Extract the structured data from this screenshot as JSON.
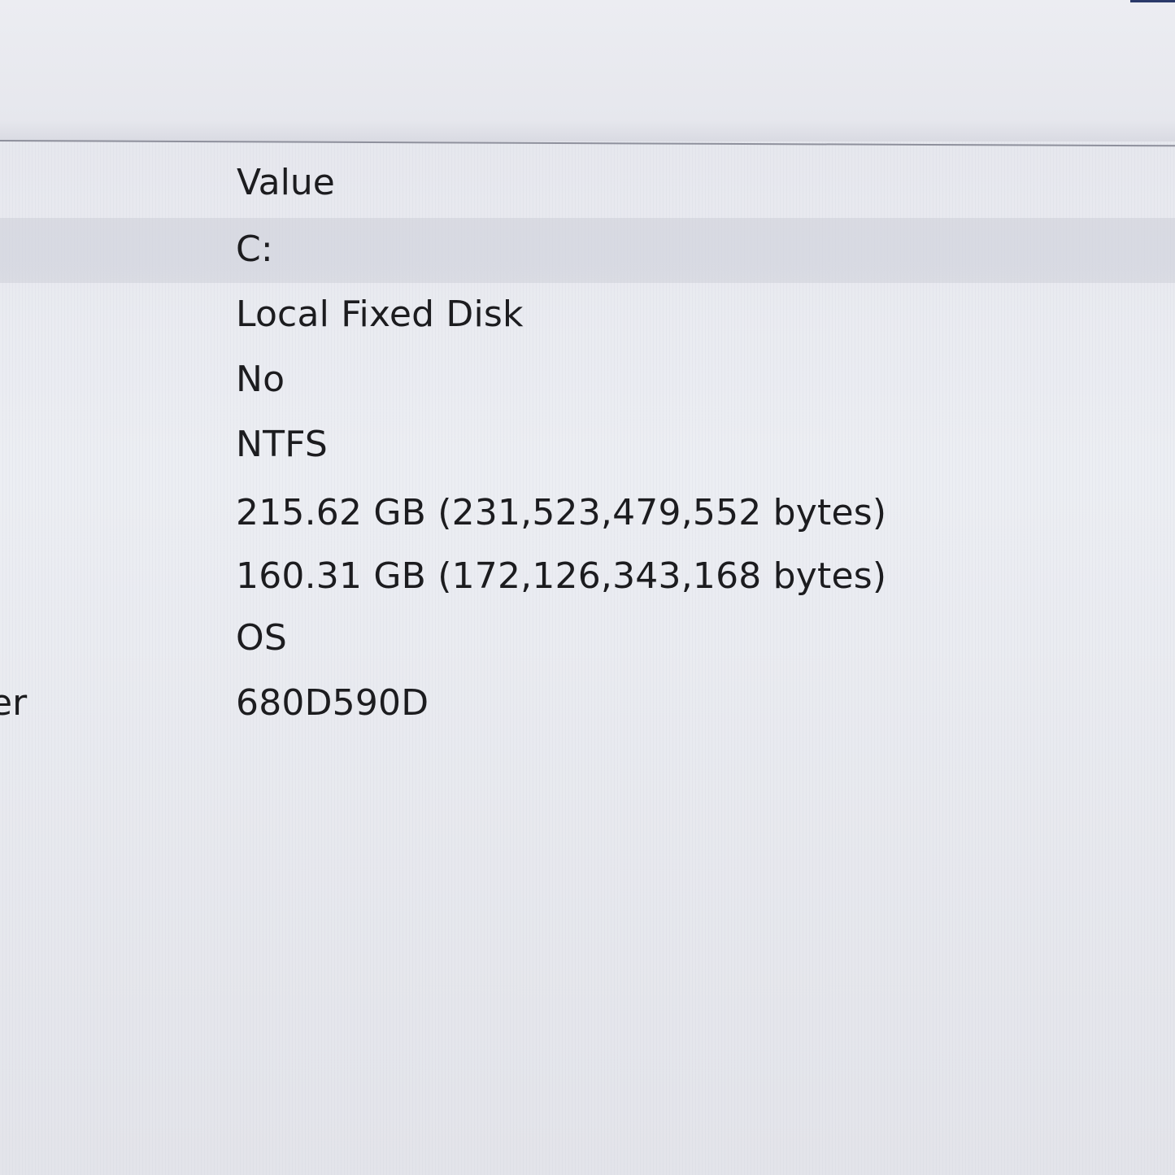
{
  "list": {
    "value_column_header": "Value",
    "rows": [
      {
        "name": "",
        "value": "C:"
      },
      {
        "name": "",
        "value": "Local Fixed Disk"
      },
      {
        "name": "",
        "value": "No"
      },
      {
        "name": "",
        "value": "NTFS"
      },
      {
        "name": "",
        "value": "215.62 GB (231,523,479,552 bytes)"
      },
      {
        "name": "",
        "value": "160.31 GB (172,126,343,168 bytes)"
      },
      {
        "name": "",
        "value": "OS"
      },
      {
        "name": "er",
        "value": "680D590D"
      }
    ],
    "selected_row_index": 0
  },
  "colors": {
    "background": "#e9eaf0",
    "text": "#1c1c1f",
    "selection": "#d2d4de",
    "divider": "#8e909c"
  }
}
